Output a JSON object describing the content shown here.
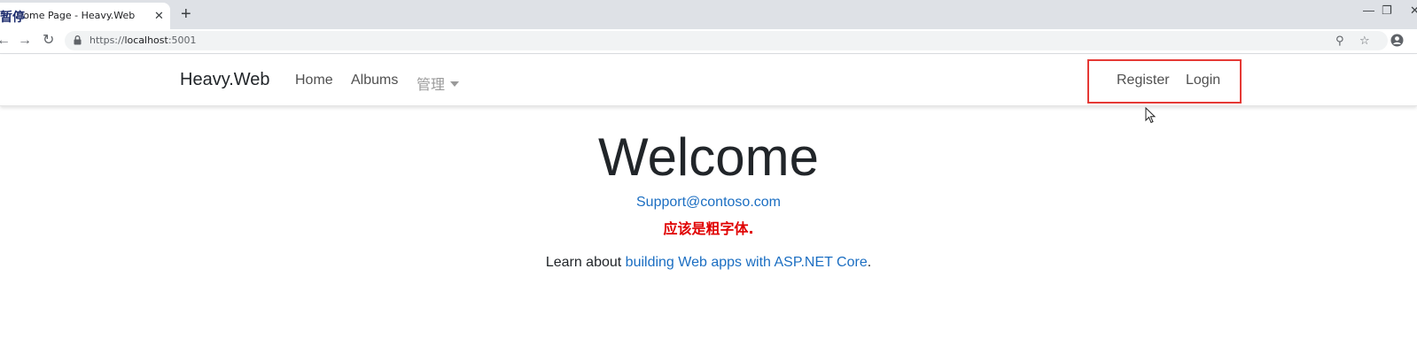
{
  "browser": {
    "tab_title": "Home Page - Heavy.Web",
    "tab_overlay_text": "暂停",
    "tab_close": "✕",
    "new_tab": "+",
    "url_scheme": "https://",
    "url_host": "localhost",
    "url_port": ":5001",
    "controls": {
      "minimize": "—",
      "restore": "❐",
      "close": "✕"
    }
  },
  "navbar": {
    "brand": "Heavy.Web",
    "links": [
      {
        "label": "Home"
      },
      {
        "label": "Albums"
      },
      {
        "label": "管理"
      }
    ],
    "register": "Register",
    "login": "Login"
  },
  "main": {
    "heading": "Welcome",
    "email": "Support@contoso.com",
    "note": "应该是粗字体.",
    "learn_prefix": "Learn about ",
    "learn_link": "building Web apps with ASP.NET Core",
    "learn_suffix": "."
  },
  "colors": {
    "link": "#1b6ec2",
    "note": "#e00000",
    "highlight": "#e53935"
  },
  "icons": [
    "back-icon",
    "forward-icon",
    "reload-icon",
    "lock-icon",
    "zoom-icon",
    "star-icon",
    "account-icon",
    "cursor-icon"
  ]
}
